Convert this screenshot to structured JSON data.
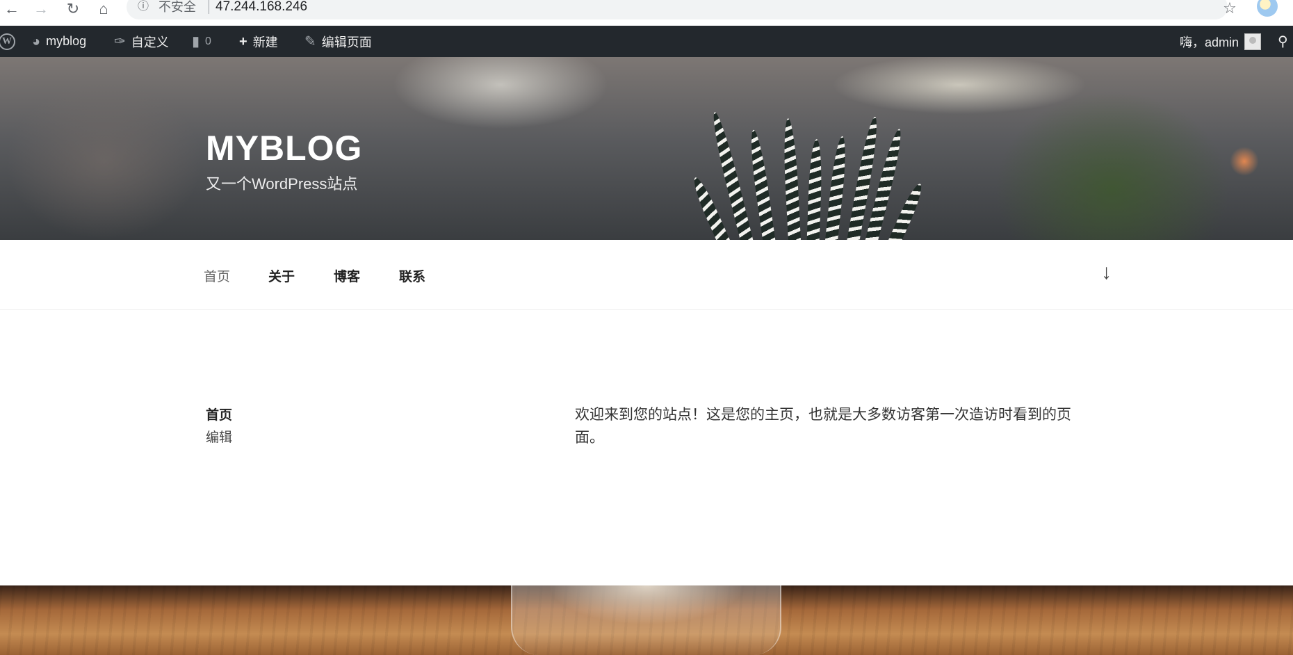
{
  "browser": {
    "insecure_label": "不安全",
    "url": "47.244.168.246"
  },
  "admin_bar": {
    "site_name": "myblog",
    "customize": "自定义",
    "comments_count": "0",
    "new": "新建",
    "edit_page": "编辑页面",
    "greeting": "嗨，admin"
  },
  "header": {
    "site_title": "MYBLOG",
    "tagline": "又一个WordPress站点"
  },
  "nav": {
    "items": [
      {
        "label": "首页"
      },
      {
        "label": "关于"
      },
      {
        "label": "博客"
      },
      {
        "label": "联系"
      }
    ]
  },
  "content": {
    "page_title": "首页",
    "edit_label": "编辑",
    "body_text": "欢迎来到您的站点！这是您的主页，也就是大多数访客第一次造访时看到的页面。"
  },
  "icons": {
    "back": "arrow-left-icon",
    "forward": "arrow-right-icon",
    "reload": "reload-icon",
    "home": "home-icon",
    "info": "info-icon",
    "bookmark": "star-icon",
    "wp": "wordpress-logo-icon",
    "dashboard": "dashboard-icon",
    "brush": "brush-icon",
    "comment": "comment-icon",
    "plus": "plus-icon",
    "pencil": "pencil-icon",
    "search": "search-icon",
    "scroll": "arrow-down-icon"
  },
  "colors": {
    "admin_bar_bg": "#23282d",
    "admin_bar_text": "#eeeeee"
  }
}
